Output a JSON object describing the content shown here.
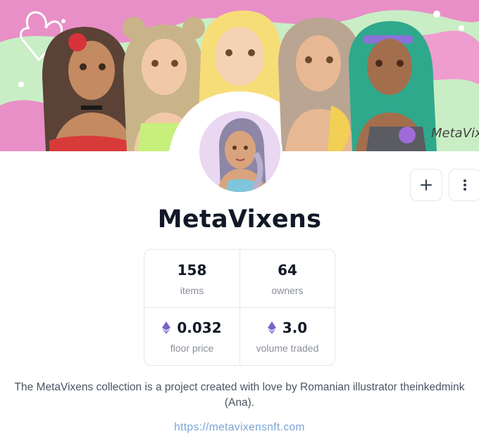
{
  "collection": {
    "name": "MetaVixens",
    "description": "The MetaVixens collection is a project created with love by Romanian illustrator theinkedmink (Ana).",
    "website": "https://metavixensnft.com",
    "banner_watermark": "MetaVixens"
  },
  "actions": {
    "add_icon": "plus-icon",
    "more_icon": "more-vertical-icon"
  },
  "stats": {
    "items": {
      "value": "158",
      "label": "items"
    },
    "owners": {
      "value": "64",
      "label": "owners"
    },
    "floor_price": {
      "value": "0.032",
      "label": "floor price",
      "icon": "ethereum-icon"
    },
    "volume_traded": {
      "value": "3.0",
      "label": "volume traded",
      "icon": "ethereum-icon"
    }
  },
  "colors": {
    "ethereum": "#7b61c9",
    "banner_green": "#c9eec5",
    "banner_pink": "#e98fc7"
  }
}
